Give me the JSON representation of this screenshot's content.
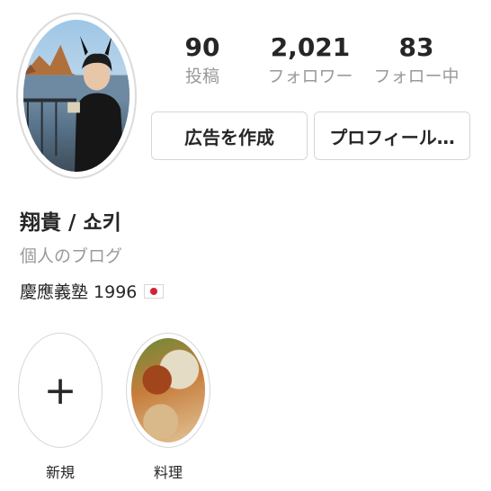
{
  "profile": {
    "name": "翔貴 / 쇼키",
    "category": "個人のブログ",
    "bio": "慶應義塾 1996",
    "flag_icon": "japan-flag-icon"
  },
  "stats": [
    {
      "value": "90",
      "label": "投稿"
    },
    {
      "value": "2,021",
      "label": "フォロワー"
    },
    {
      "value": "83",
      "label": "フォロー中"
    }
  ],
  "buttons": {
    "promote": "広告を作成",
    "edit_profile": "プロフィール…"
  },
  "highlights": [
    {
      "label": "新規",
      "icon": "plus-icon"
    },
    {
      "label": "料理",
      "icon": "food-photo"
    }
  ],
  "colors": {
    "text": "#262626",
    "secondary": "#9a9a9a",
    "border": "#dbdbdb"
  }
}
